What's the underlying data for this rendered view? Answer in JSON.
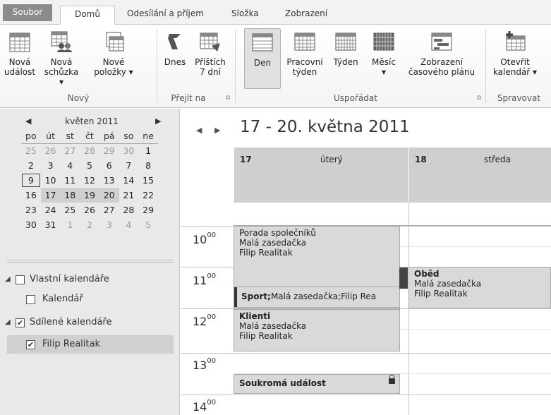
{
  "tabs": [
    "Soubor",
    "Domů",
    "Odesílání a příjem",
    "Složka",
    "Zobrazení"
  ],
  "ribbon": {
    "buttons": {
      "nova_udalost": [
        "Nová",
        "událost"
      ],
      "nova_schuzka": [
        "Nová",
        "schůzka ▾"
      ],
      "nove_polozky": [
        "Nové",
        "položky ▾"
      ],
      "dnes": "Dnes",
      "pristich": [
        "Příštích",
        "7 dní"
      ],
      "den": "Den",
      "pracovni_tyden": [
        "Pracovní",
        "týden"
      ],
      "tyden": "Týden",
      "mesic": [
        "Měsíc",
        "▾"
      ],
      "zobrazeni": [
        "Zobrazení",
        "časového plánu"
      ],
      "otevrit": [
        "Otevřít",
        "kalendář ▾"
      ]
    },
    "groups": [
      "Nový",
      "Přejít na",
      "Uspořádat",
      "Spravovat"
    ]
  },
  "mini_calendar": {
    "month": "květen 2011",
    "weekdays": [
      "po",
      "út",
      "st",
      "čt",
      "pá",
      "so",
      "ne"
    ],
    "weeks": [
      [
        "25",
        "26",
        "27",
        "28",
        "29",
        "30",
        "1"
      ],
      [
        "2",
        "3",
        "4",
        "5",
        "6",
        "7",
        "8"
      ],
      [
        "9",
        "10",
        "11",
        "12",
        "13",
        "14",
        "15"
      ],
      [
        "16",
        "17",
        "18",
        "19",
        "20",
        "21",
        "22"
      ],
      [
        "23",
        "24",
        "25",
        "26",
        "27",
        "28",
        "29"
      ],
      [
        "30",
        "31",
        "1",
        "2",
        "3",
        "4",
        "5"
      ]
    ]
  },
  "tree": {
    "vlastni": "Vlastní kalendáře",
    "kalendar": "Kalendář",
    "sdilene": "Sdílené kalendáře",
    "filip": "Filip Realitak"
  },
  "calendar": {
    "title": "17 - 20. května 2011",
    "days": [
      {
        "num": "17",
        "name": "úterý"
      },
      {
        "num": "18",
        "name": "středa"
      }
    ],
    "hours": [
      "10",
      "11",
      "12",
      "13",
      "14"
    ],
    "minutes": "00",
    "appointments": {
      "porada": {
        "title": "Porada společníků",
        "room": "Malá zasedačka",
        "org": "Filip Realitak"
      },
      "sport": {
        "title": "Sport;",
        "rest": "Malá zasedačka;Filip Rea"
      },
      "obed": {
        "title": "Oběd",
        "room": "Malá zasedačka",
        "org": "Filip Realitak"
      },
      "klienti": {
        "title": "Klienti",
        "room": "Malá zasedačka",
        "org": "Filip Realitak"
      },
      "soukroma": {
        "title": "Soukromá událost"
      }
    }
  }
}
